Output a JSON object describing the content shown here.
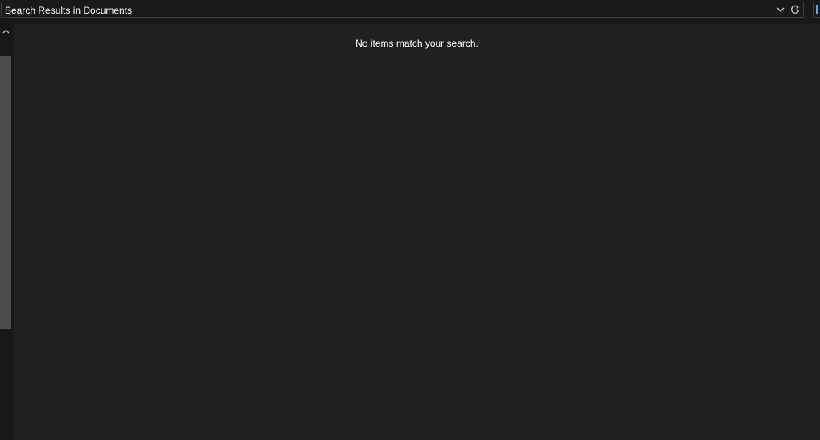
{
  "address_bar": {
    "title": "Search Results in Documents",
    "dropdown_icon": "chevron-down-icon",
    "refresh_icon": "refresh-icon"
  },
  "navigation_pane": {
    "scroll_up_icon": "chevron-up-icon"
  },
  "results": {
    "empty_message": "No items match your search."
  },
  "colors": {
    "background": "#191919",
    "results_background": "#202020",
    "scrollbar_thumb": "#4d4d4d",
    "border": "#3c3c3c",
    "text": "#ffffff",
    "accent": "#5ca8e6"
  }
}
